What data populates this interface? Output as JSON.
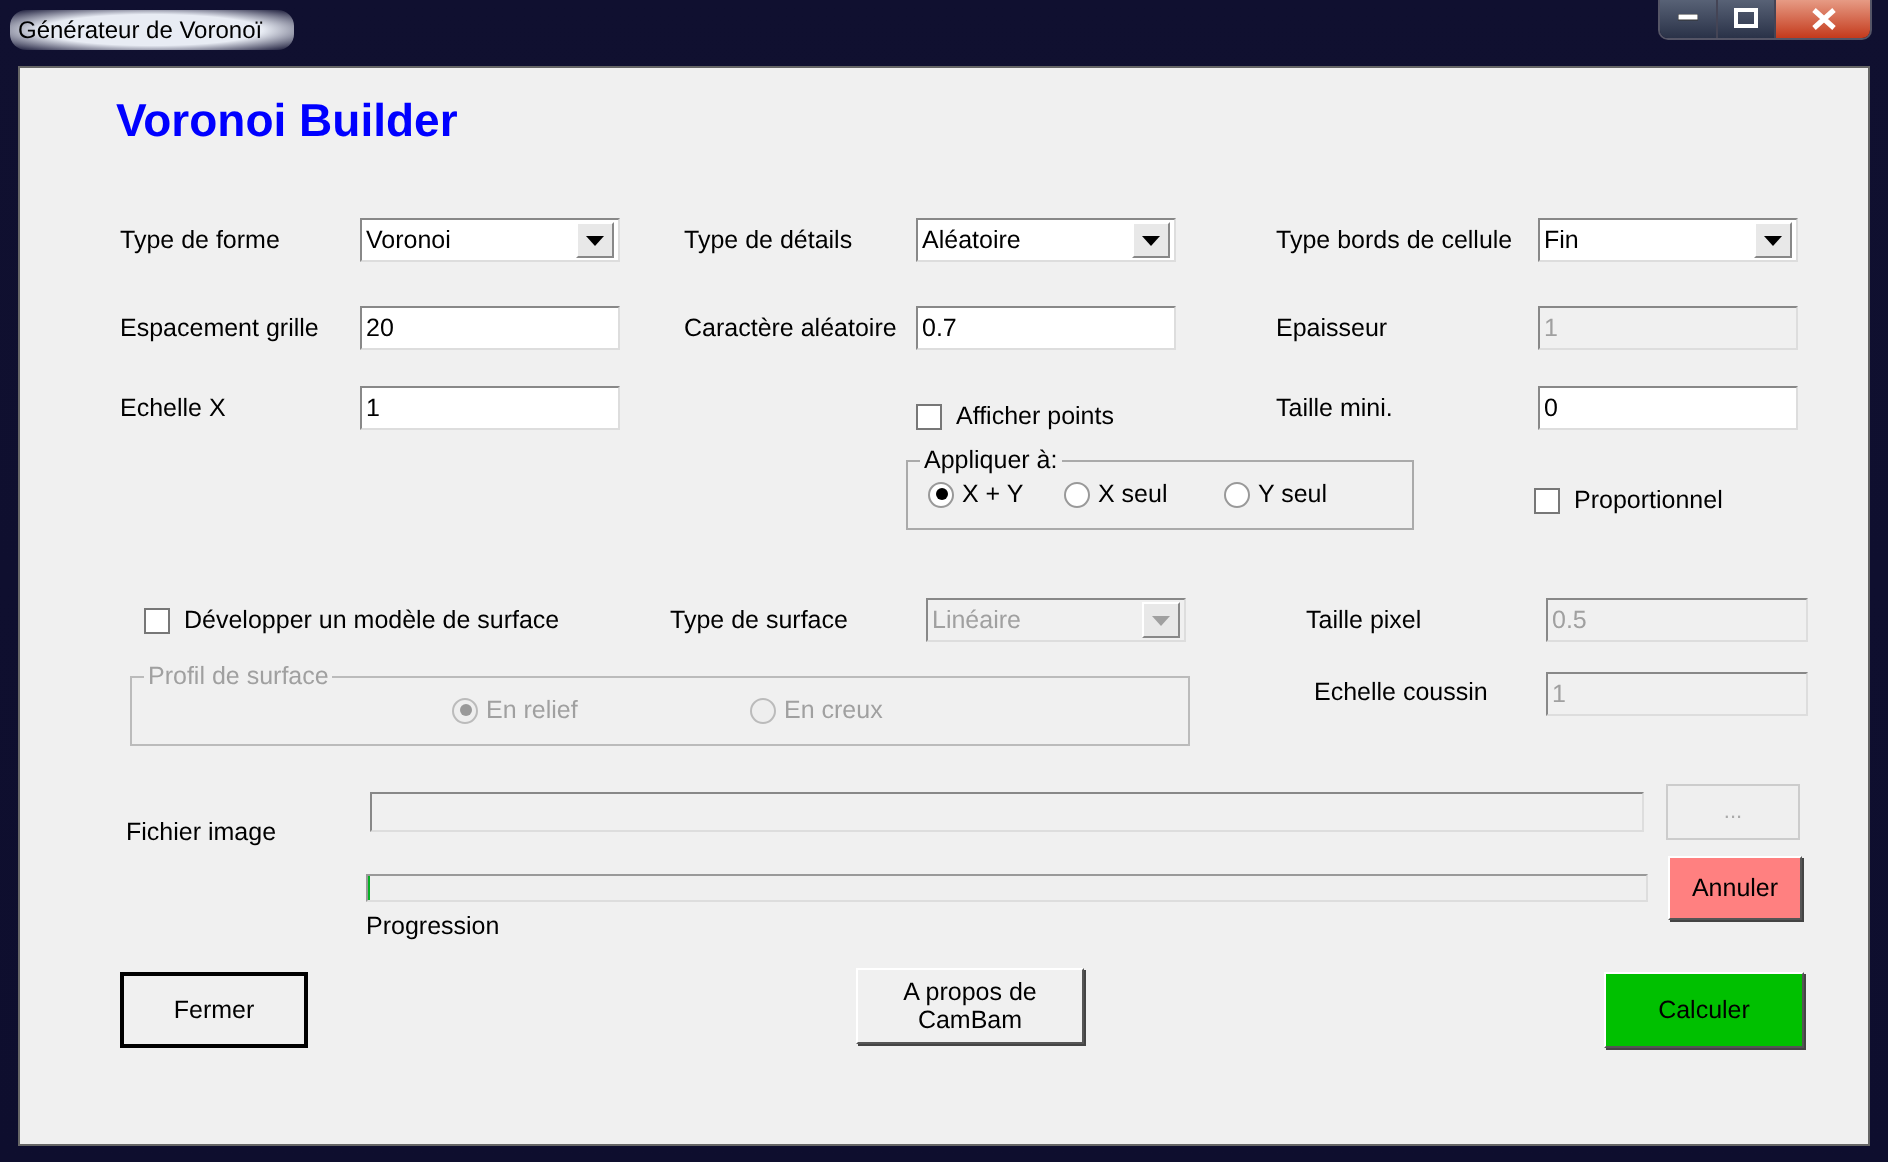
{
  "window": {
    "title": "Générateur de Voronoï"
  },
  "heading": "Voronoi Builder",
  "grid_fields": [
    {
      "kind": "dropdown",
      "label": "Type de forme",
      "value": "Voronoi"
    },
    {
      "kind": "dropdown",
      "label": "Type de détails",
      "value": "Aléatoire"
    },
    {
      "kind": "dropdown",
      "label": "Type bords de cellule",
      "value": "Fin"
    },
    {
      "kind": "text",
      "label": "Espacement grille",
      "value": "20"
    },
    {
      "kind": "text",
      "label": "Caractère aléatoire",
      "value": "0.7"
    },
    {
      "kind": "text",
      "label": "Epaisseur",
      "value": "1",
      "disabled": true
    },
    {
      "kind": "text",
      "label": "Echelle X",
      "value": "1"
    },
    {
      "kind": "checkbox",
      "label": "Afficher points",
      "checked": false
    },
    {
      "kind": "text",
      "label": "Taille mini.",
      "value": "0"
    }
  ],
  "apply_group": {
    "label": "Appliquer à:",
    "options": [
      {
        "label": "X + Y",
        "selected": true
      },
      {
        "label": "X seul",
        "selected": false
      },
      {
        "label": "Y seul",
        "selected": false
      }
    ]
  },
  "proportional": {
    "label": "Proportionnel",
    "checked": false
  },
  "surface_model": {
    "label": "Développer un modèle de surface",
    "checked": false
  },
  "surface_type": {
    "label": "Type de surface",
    "value": "Linéaire",
    "disabled": true
  },
  "pixel_size": {
    "label": "Taille pixel",
    "value": "0.5",
    "disabled": true
  },
  "profile_group": {
    "label": "Profil de surface",
    "disabled": true,
    "options": [
      {
        "label": "En relief",
        "selected": true
      },
      {
        "label": "En creux",
        "selected": false
      }
    ]
  },
  "cushion_scale": {
    "label": "Echelle coussin",
    "value": "1",
    "disabled": true
  },
  "image_file": {
    "label": "Fichier image",
    "browse_label": "...",
    "browse_disabled": true
  },
  "progress": {
    "label": "Progression",
    "level": 0
  },
  "cancel_button": {
    "label": "Annuler",
    "color": "#ff8080"
  },
  "buttons": [
    {
      "label": "Fermer",
      "color": "#f0f0f0",
      "kind": "default"
    },
    {
      "label": "A propos de CamBam",
      "color": "#f0f0f0",
      "kind": "normal"
    },
    {
      "label": "Calculer",
      "color": "#00c000",
      "kind": "normal"
    }
  ]
}
